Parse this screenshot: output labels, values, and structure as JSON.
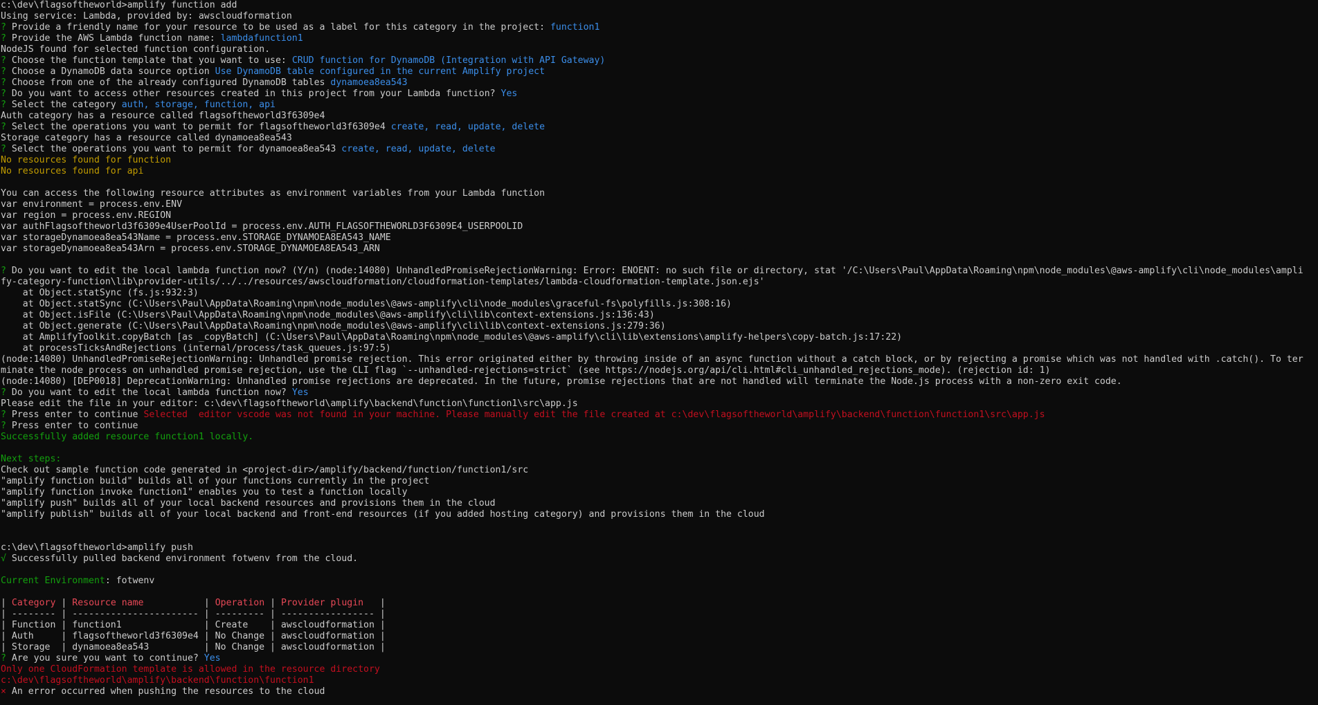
{
  "window": {
    "type": "command-prompt",
    "background_color": "#0c0c0c"
  },
  "palette": {
    "default": "#cccccc",
    "green": "#13a10e",
    "blue": "#3b8eea",
    "yellow": "#c19c00",
    "red": "#e74856",
    "red2": "#c50f1f"
  },
  "lines": [
    [
      {
        "t": "c:\\dev\\flagsoftheworld>amplify function add",
        "c": "default"
      }
    ],
    [
      {
        "t": "Using service: Lambda, provided by: awscloudformation",
        "c": "default"
      }
    ],
    [
      {
        "t": "? ",
        "c": "green"
      },
      {
        "t": "Provide a friendly name for your resource to be used as a label for this category in the project: ",
        "c": "default"
      },
      {
        "t": "function1",
        "c": "blue"
      }
    ],
    [
      {
        "t": "? ",
        "c": "green"
      },
      {
        "t": "Provide the AWS Lambda function name: ",
        "c": "default"
      },
      {
        "t": "lambdafunction1",
        "c": "blue"
      }
    ],
    [
      {
        "t": "NodeJS found for selected function configuration.",
        "c": "default"
      }
    ],
    [
      {
        "t": "? ",
        "c": "green"
      },
      {
        "t": "Choose the function template that you want to use: ",
        "c": "default"
      },
      {
        "t": "CRUD function for DynamoDB (Integration with API Gateway)",
        "c": "blue"
      }
    ],
    [
      {
        "t": "? ",
        "c": "green"
      },
      {
        "t": "Choose a DynamoDB data source option ",
        "c": "default"
      },
      {
        "t": "Use DynamoDB table configured in the current Amplify project",
        "c": "blue"
      }
    ],
    [
      {
        "t": "? ",
        "c": "green"
      },
      {
        "t": "Choose from one of the already configured DynamoDB tables ",
        "c": "default"
      },
      {
        "t": "dynamoea8ea543",
        "c": "blue"
      }
    ],
    [
      {
        "t": "? ",
        "c": "green"
      },
      {
        "t": "Do you want to access other resources created in this project from your Lambda function? ",
        "c": "default"
      },
      {
        "t": "Yes",
        "c": "blue"
      }
    ],
    [
      {
        "t": "? ",
        "c": "green"
      },
      {
        "t": "Select the category ",
        "c": "default"
      },
      {
        "t": "auth, storage, function, api",
        "c": "blue"
      }
    ],
    [
      {
        "t": "Auth category has a resource called flagsoftheworld3f6309e4",
        "c": "default"
      }
    ],
    [
      {
        "t": "? ",
        "c": "green"
      },
      {
        "t": "Select the operations you want to permit for flagsoftheworld3f6309e4 ",
        "c": "default"
      },
      {
        "t": "create, read, update, delete",
        "c": "blue"
      }
    ],
    [
      {
        "t": "Storage category has a resource called dynamoea8ea543",
        "c": "default"
      }
    ],
    [
      {
        "t": "? ",
        "c": "green"
      },
      {
        "t": "Select the operations you want to permit for dynamoea8ea543 ",
        "c": "default"
      },
      {
        "t": "create, read, update, delete",
        "c": "blue"
      }
    ],
    [
      {
        "t": "No resources found for function",
        "c": "yellow"
      }
    ],
    [
      {
        "t": "No resources found for api",
        "c": "yellow"
      }
    ],
    [],
    [
      {
        "t": "You can access the following resource attributes as environment variables from your Lambda function",
        "c": "default"
      }
    ],
    [
      {
        "t": "var environment = process.env.ENV",
        "c": "default"
      }
    ],
    [
      {
        "t": "var region = process.env.REGION",
        "c": "default"
      }
    ],
    [
      {
        "t": "var authFlagsoftheworld3f6309e4UserPoolId = process.env.AUTH_FLAGSOFTHEWORLD3F6309E4_USERPOOLID",
        "c": "default"
      }
    ],
    [
      {
        "t": "var storageDynamoea8ea543Name = process.env.STORAGE_DYNAMOEA8EA543_NAME",
        "c": "default"
      }
    ],
    [
      {
        "t": "var storageDynamoea8ea543Arn = process.env.STORAGE_DYNAMOEA8EA543_ARN",
        "c": "default"
      }
    ],
    [],
    [
      {
        "t": "? ",
        "c": "green"
      },
      {
        "t": "Do you want to edit the local lambda function now? (Y/n) (node:14080) UnhandledPromiseRejectionWarning: Error: ENOENT: no such file or directory, stat '/C:\\Users\\Paul\\AppData\\Roaming\\npm\\node_modules\\@aws-amplify\\cli\\node_modules\\ampli",
        "c": "default"
      }
    ],
    [
      {
        "t": "fy-category-function\\lib\\provider-utils/../../resources/awscloudformation/cloudformation-templates/lambda-cloudformation-template.json.ejs'",
        "c": "default"
      }
    ],
    [
      {
        "t": "    at Object.statSync (fs.js:932:3)",
        "c": "default"
      }
    ],
    [
      {
        "t": "    at Object.statSync (C:\\Users\\Paul\\AppData\\Roaming\\npm\\node_modules\\@aws-amplify\\cli\\node_modules\\graceful-fs\\polyfills.js:308:16)",
        "c": "default"
      }
    ],
    [
      {
        "t": "    at Object.isFile (C:\\Users\\Paul\\AppData\\Roaming\\npm\\node_modules\\@aws-amplify\\cli\\lib\\context-extensions.js:136:43)",
        "c": "default"
      }
    ],
    [
      {
        "t": "    at Object.generate (C:\\Users\\Paul\\AppData\\Roaming\\npm\\node_modules\\@aws-amplify\\cli\\lib\\context-extensions.js:279:36)",
        "c": "default"
      }
    ],
    [
      {
        "t": "    at AmplifyToolkit.copyBatch [as _copyBatch] (C:\\Users\\Paul\\AppData\\Roaming\\npm\\node_modules\\@aws-amplify\\cli\\lib\\extensions\\amplify-helpers\\copy-batch.js:17:22)",
        "c": "default"
      }
    ],
    [
      {
        "t": "    at processTicksAndRejections (internal/process/task_queues.js:97:5)",
        "c": "default"
      }
    ],
    [
      {
        "t": "(node:14080) UnhandledPromiseRejectionWarning: Unhandled promise rejection. This error originated either by throwing inside of an async function without a catch block, or by rejecting a promise which was not handled with .catch(). To ter",
        "c": "default"
      }
    ],
    [
      {
        "t": "minate the node process on unhandled promise rejection, use the CLI flag `--unhandled-rejections=strict` (see https://nodejs.org/api/cli.html#cli_unhandled_rejections_mode). (rejection id: 1)",
        "c": "default"
      }
    ],
    [
      {
        "t": "(node:14080) [DEP0018] DeprecationWarning: Unhandled promise rejections are deprecated. In the future, promise rejections that are not handled will terminate the Node.js process with a non-zero exit code.",
        "c": "default"
      }
    ],
    [
      {
        "t": "? ",
        "c": "green"
      },
      {
        "t": "Do you want to edit the local lambda function now? ",
        "c": "default"
      },
      {
        "t": "Yes",
        "c": "blue"
      }
    ],
    [
      {
        "t": "Please edit the file in your editor: c:\\dev\\flagsoftheworld\\amplify\\backend\\function\\function1\\src\\app.js",
        "c": "default"
      }
    ],
    [
      {
        "t": "? ",
        "c": "green"
      },
      {
        "t": "Press enter to continue ",
        "c": "default"
      },
      {
        "t": "Selected  editor vscode was not found in your machine. Please manually edit the file created at c:\\dev\\flagsoftheworld\\amplify\\backend\\function\\function1\\src\\app.js",
        "c": "red2"
      }
    ],
    [
      {
        "t": "? ",
        "c": "green"
      },
      {
        "t": "Press enter to continue",
        "c": "default"
      }
    ],
    [
      {
        "t": "Successfully added resource function1 locally.",
        "c": "green"
      }
    ],
    [],
    [
      {
        "t": "Next steps:",
        "c": "green"
      }
    ],
    [
      {
        "t": "Check out sample function code generated in <project-dir>/amplify/backend/function/function1/src",
        "c": "default"
      }
    ],
    [
      {
        "t": "\"amplify function build\" builds all of your functions currently in the project",
        "c": "default"
      }
    ],
    [
      {
        "t": "\"amplify function invoke function1\" enables you to test a function locally",
        "c": "default"
      }
    ],
    [
      {
        "t": "\"amplify push\" builds all of your local backend resources and provisions them in the cloud",
        "c": "default"
      }
    ],
    [
      {
        "t": "\"amplify publish\" builds all of your local backend and front-end resources (if you added hosting category) and provisions them in the cloud",
        "c": "default"
      }
    ],
    [],
    [],
    [
      {
        "t": "c:\\dev\\flagsoftheworld>amplify push",
        "c": "default"
      }
    ],
    [
      {
        "t": "√ ",
        "c": "green"
      },
      {
        "t": "Successfully pulled backend environment fotwenv from the cloud.",
        "c": "default"
      }
    ],
    [],
    [
      {
        "t": "Current Environment",
        "c": "green"
      },
      {
        "t": ": fotwenv",
        "c": "default"
      }
    ],
    [],
    [
      {
        "t": "| ",
        "c": "default"
      },
      {
        "t": "Category",
        "c": "red"
      },
      {
        "t": " | ",
        "c": "default"
      },
      {
        "t": "Resource name          ",
        "c": "red"
      },
      {
        "t": " | ",
        "c": "default"
      },
      {
        "t": "Operation",
        "c": "red"
      },
      {
        "t": " | ",
        "c": "default"
      },
      {
        "t": "Provider plugin  ",
        "c": "red"
      },
      {
        "t": " |",
        "c": "default"
      }
    ],
    [
      {
        "t": "| -------- | ----------------------- | --------- | ----------------- |",
        "c": "default"
      }
    ],
    [
      {
        "t": "| Function | function1               | Create    | awscloudformation |",
        "c": "default"
      }
    ],
    [
      {
        "t": "| Auth     | flagsoftheworld3f6309e4 | No Change | awscloudformation |",
        "c": "default"
      }
    ],
    [
      {
        "t": "| Storage  | dynamoea8ea543          | No Change | awscloudformation |",
        "c": "default"
      }
    ],
    [
      {
        "t": "? ",
        "c": "green"
      },
      {
        "t": "Are you sure you want to continue? ",
        "c": "default"
      },
      {
        "t": "Yes",
        "c": "blue"
      }
    ],
    [
      {
        "t": "Only one CloudFormation template is allowed in the resource directory",
        "c": "red2"
      }
    ],
    [
      {
        "t": "c:\\dev\\flagsoftheworld\\amplify\\backend\\function\\function1",
        "c": "red2"
      }
    ],
    [
      {
        "t": "× ",
        "c": "red2"
      },
      {
        "t": "An error occurred when pushing the resources to the cloud",
        "c": "default"
      }
    ]
  ]
}
